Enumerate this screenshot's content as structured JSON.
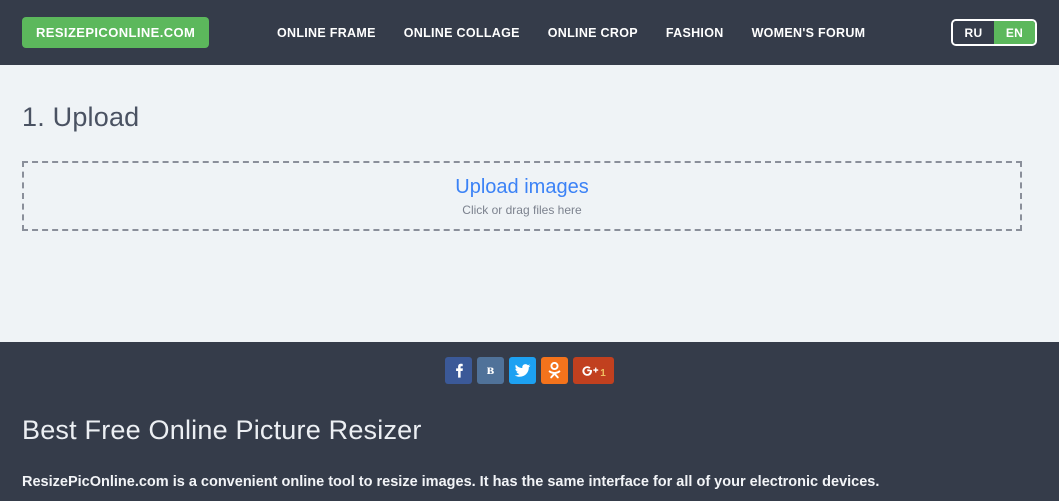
{
  "header": {
    "logo": "RESIZEPICONLINE.COM",
    "nav": [
      {
        "label": "ONLINE FRAME"
      },
      {
        "label": "ONLINE COLLAGE"
      },
      {
        "label": "ONLINE CROP"
      },
      {
        "label": "FASHION"
      },
      {
        "label": "WOMEN'S FORUM"
      }
    ],
    "language": {
      "options": [
        {
          "code": "RU",
          "active": false
        },
        {
          "code": "EN",
          "active": true
        }
      ],
      "selected": "EN"
    },
    "colors": {
      "background": "#353c4a",
      "logo_background": "#5cb85c",
      "active_language": "#5cb85c"
    }
  },
  "main": {
    "step_title": "1. Upload",
    "dropzone": {
      "title": "Upload images",
      "subtitle": "Click or drag files here",
      "title_color": "#3b82f6",
      "border_color": "#8a8f9a"
    },
    "background": "#eff3f6"
  },
  "footer": {
    "social": [
      {
        "name": "facebook",
        "glyph": "f",
        "color": "#3b5998"
      },
      {
        "name": "vkontakte",
        "glyph": "B",
        "color": "#507299"
      },
      {
        "name": "twitter",
        "glyph": "",
        "color": "#1da1f2"
      },
      {
        "name": "odnoklassniki",
        "glyph": "",
        "color": "#f4731c"
      },
      {
        "name": "google-plus",
        "glyph": "g+",
        "color": "#c1401f",
        "count": "1"
      }
    ],
    "heading": "Best Free Online Picture Resizer",
    "paragraph": "ResizePicOnline.com is a convenient online tool to resize images. It has the same interface for all of your electronic devices.",
    "background": "#353c4a"
  }
}
